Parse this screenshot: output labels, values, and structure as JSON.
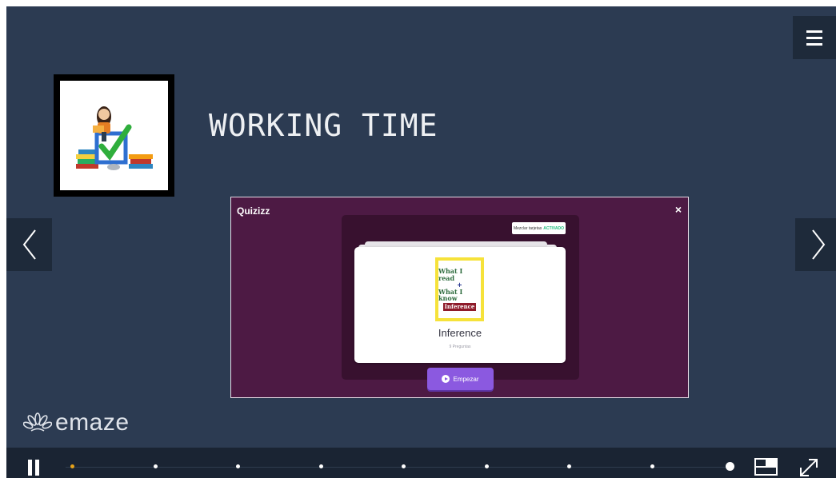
{
  "slide": {
    "title": "WORKING TIME"
  },
  "quiz": {
    "logo": "Quizizz",
    "close_label": "×",
    "shuffle_label": "Mezclar tarjetas",
    "shuffle_state": "ACTIVADO",
    "cover": {
      "line1": "What I read",
      "line2": "+",
      "line3": "What I know",
      "line4": "Inference"
    },
    "name": "Inference",
    "questions": "9 Preguntas",
    "start_label": "Empezar"
  },
  "brand": {
    "name": "emaze"
  },
  "player": {
    "slide_count": 9,
    "current_slide": 1,
    "icons": [
      "menu-icon",
      "chevron-left-icon",
      "chevron-right-icon",
      "pause-icon",
      "layout-icon",
      "expand-icon"
    ]
  },
  "colors": {
    "stage_bg": "#2c3b52",
    "quiz_bg": "#4d1a44",
    "start_button": "#8b59e0",
    "active_dot": "#e6a21a"
  }
}
